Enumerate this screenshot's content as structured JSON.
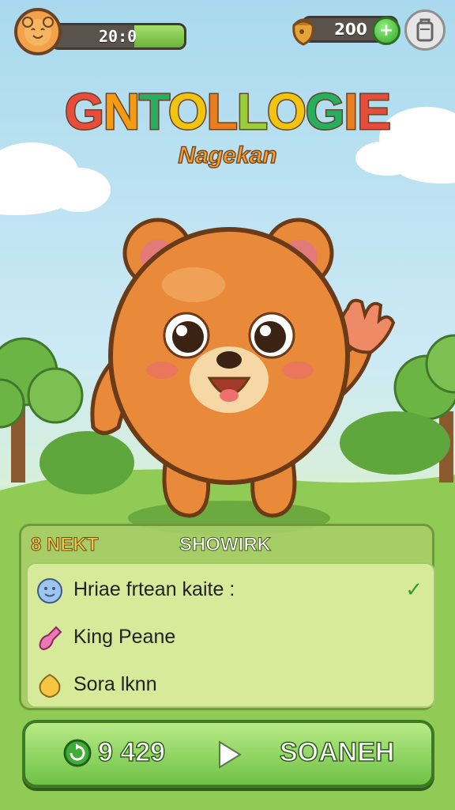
{
  "hud": {
    "xp_text": "20:0",
    "xp_fill_percent": 38,
    "coins_text": "200",
    "plus_label": "+"
  },
  "title": {
    "main": "GNTOLLOGIE",
    "letter_colors": [
      "#e74c3c",
      "#f39c12",
      "#27ae60",
      "#f1c40f",
      "#e67e22",
      "#9bcf3a",
      "#f1c40f",
      "#27ae60",
      "#e67e22",
      "#e74c3c"
    ],
    "subtitle": "Nagekan"
  },
  "panel": {
    "left_header": "8 NEKT",
    "center_header": "SHOWIRK",
    "items": [
      {
        "icon": "blue-smiley-icon",
        "label": "Hriae frtean kaite :",
        "checked": true
      },
      {
        "icon": "pink-bottle-icon",
        "label": "King Peane",
        "checked": false
      },
      {
        "icon": "yellow-leaf-icon",
        "label": "Sora lknn",
        "checked": false
      }
    ],
    "check_glyph": "✓"
  },
  "button": {
    "cost": "9 429",
    "label": "SOANEH"
  },
  "colors": {
    "sky": "#a9d9ee",
    "grass": "#8fcb55",
    "bear": "#e98a3a",
    "accent_green": "#6fc246"
  }
}
